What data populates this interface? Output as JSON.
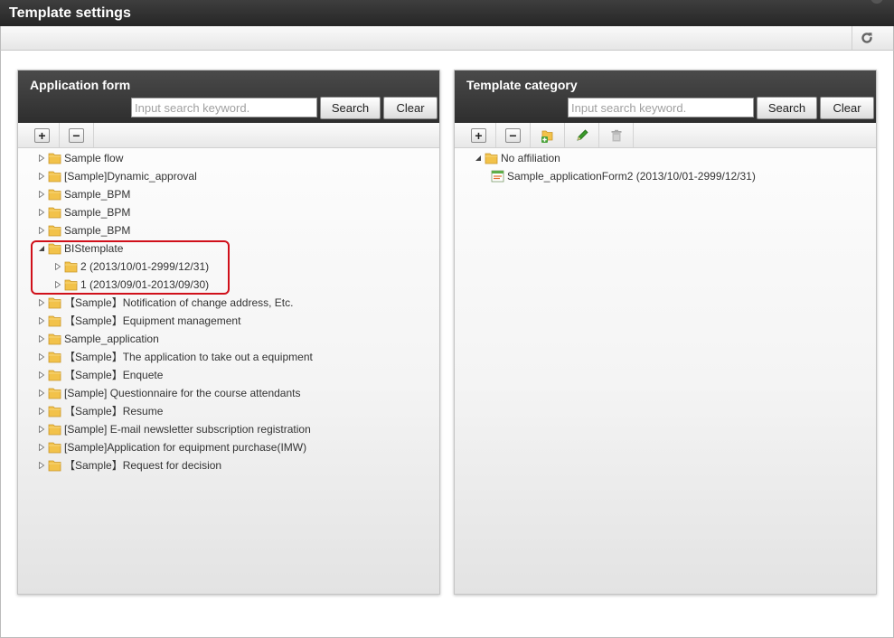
{
  "window": {
    "title": "Template settings"
  },
  "toolbar": {
    "reload_icon": "reload-icon"
  },
  "left_panel": {
    "title": "Application form",
    "search_placeholder": "Input search keyword.",
    "search_label": "Search",
    "clear_label": "Clear",
    "toolbar_icons": [
      "expand-all-icon",
      "collapse-all-icon"
    ],
    "tree": [
      {
        "label": "Sample flow",
        "expanded": false,
        "level": 0
      },
      {
        "label": "[Sample]Dynamic_approval",
        "expanded": false,
        "level": 0
      },
      {
        "label": "Sample_BPM",
        "expanded": false,
        "level": 0
      },
      {
        "label": "Sample_BPM",
        "expanded": false,
        "level": 0
      },
      {
        "label": "Sample_BPM",
        "expanded": false,
        "level": 0
      },
      {
        "label": "BIStemplate",
        "expanded": true,
        "level": 0
      },
      {
        "label": "2 (2013/10/01-2999/12/31)",
        "expanded": false,
        "level": 1
      },
      {
        "label": "1 (2013/09/01-2013/09/30)",
        "expanded": false,
        "level": 1
      },
      {
        "label": "【Sample】Notification of change address, Etc.",
        "expanded": false,
        "level": 0
      },
      {
        "label": "【Sample】Equipment management",
        "expanded": false,
        "level": 0
      },
      {
        "label": "Sample_application",
        "expanded": false,
        "level": 0
      },
      {
        "label": "【Sample】The application to take out a equipment",
        "expanded": false,
        "level": 0
      },
      {
        "label": "【Sample】Enquete",
        "expanded": false,
        "level": 0
      },
      {
        "label": "[Sample] Questionnaire for the course attendants",
        "expanded": false,
        "level": 0
      },
      {
        "label": "【Sample】Resume",
        "expanded": false,
        "level": 0
      },
      {
        "label": "[Sample] E-mail newsletter subscription registration",
        "expanded": false,
        "level": 0
      },
      {
        "label": "[Sample]Application for equipment purchase(IMW)",
        "expanded": false,
        "level": 0
      },
      {
        "label": "【Sample】Request for decision",
        "expanded": false,
        "level": 0
      }
    ]
  },
  "right_panel": {
    "title": "Template category",
    "search_placeholder": "Input search keyword.",
    "search_label": "Search",
    "clear_label": "Clear",
    "toolbar_icons": [
      "expand-all-icon",
      "collapse-all-icon",
      "add-category-icon",
      "edit-pencil-icon",
      "trash-icon"
    ],
    "tree": [
      {
        "label": "No affiliation",
        "expanded": true,
        "level": 0,
        "icon": "folder-icon"
      },
      {
        "label": "Sample_applicationForm2 (2013/10/01-2999/12/31)",
        "level": 1,
        "icon": "form-icon"
      }
    ]
  },
  "colors": {
    "header_bg": "#2e2e2e",
    "highlight": "#d0101a",
    "folder": "#f2c24a",
    "pencil": "#3a9a2a"
  }
}
